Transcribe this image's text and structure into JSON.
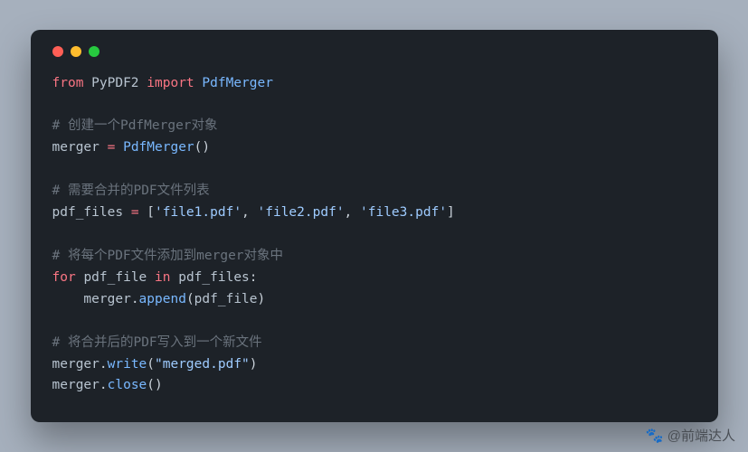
{
  "window": {
    "traffic_lights": [
      "red",
      "yellow",
      "green"
    ]
  },
  "code": {
    "line1": {
      "kw1": "from",
      "mod": "PyPDF2",
      "kw2": "import",
      "cls": "PdfMerger"
    },
    "line3": {
      "comment": "# 创建一个PdfMerger对象"
    },
    "line4": {
      "ident": "merger",
      "op": "=",
      "cls": "PdfMerger",
      "paren": "()"
    },
    "line6": {
      "comment": "# 需要合并的PDF文件列表"
    },
    "line7": {
      "ident": "pdf_files",
      "op": "=",
      "lb": "[",
      "s1": "'file1.pdf'",
      "c1": ",",
      "s2": "'file2.pdf'",
      "c2": ",",
      "s3": "'file3.pdf'",
      "rb": "]"
    },
    "line9": {
      "comment": "# 将每个PDF文件添加到merger对象中"
    },
    "line10": {
      "kw1": "for",
      "var": "pdf_file",
      "kw2": "in",
      "iter": "pdf_files",
      "colon": ":"
    },
    "line11": {
      "indent": "    ",
      "obj": "merger",
      "dot": ".",
      "method": "append",
      "lp": "(",
      "arg": "pdf_file",
      "rp": ")"
    },
    "line13": {
      "comment": "# 将合并后的PDF写入到一个新文件"
    },
    "line14": {
      "obj": "merger",
      "dot": ".",
      "method": "write",
      "lp": "(",
      "arg": "\"merged.pdf\"",
      "rp": ")"
    },
    "line15": {
      "obj": "merger",
      "dot": ".",
      "method": "close",
      "lp": "(",
      "rp": ")"
    }
  },
  "watermark": {
    "icon": "🐾",
    "text": "@前端达人"
  }
}
